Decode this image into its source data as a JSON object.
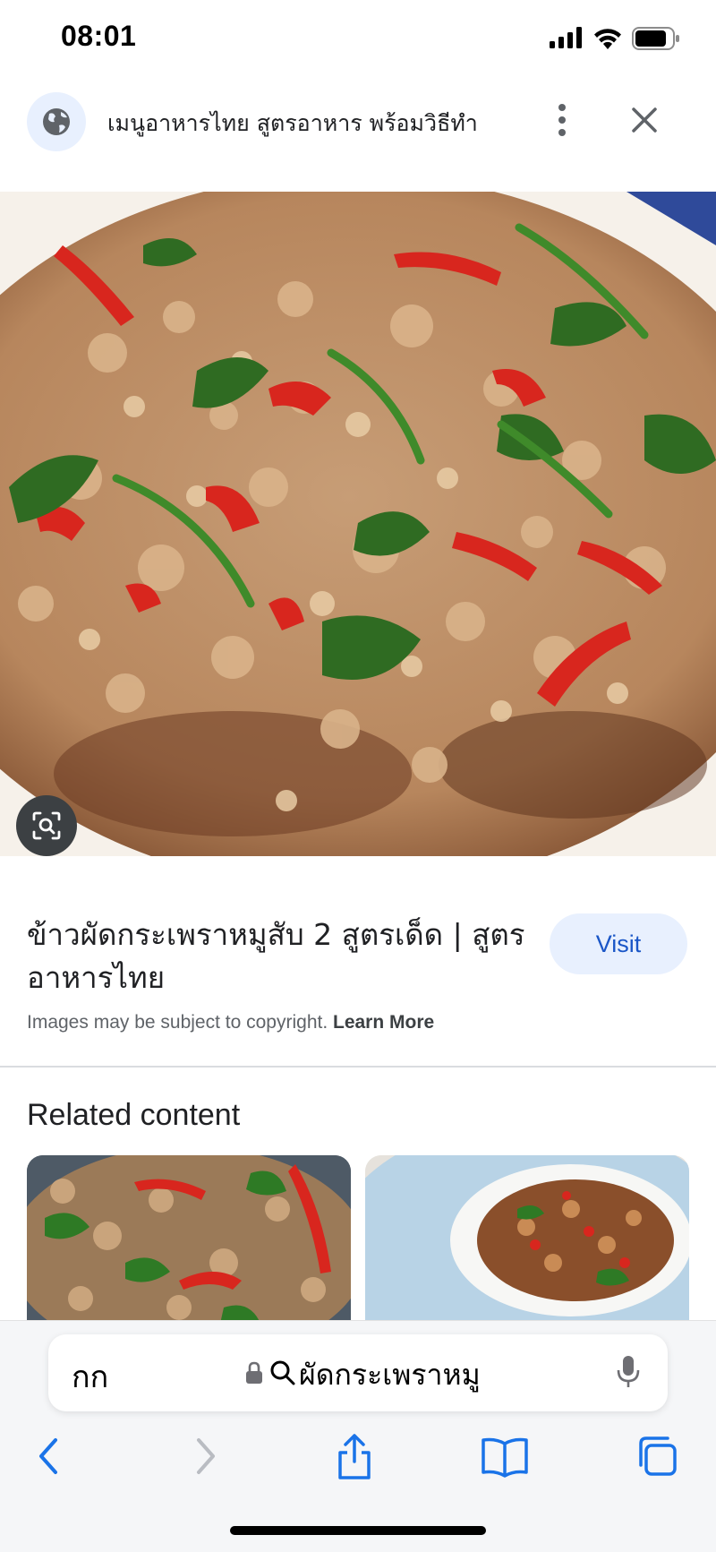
{
  "status_bar": {
    "time": "08:01"
  },
  "header": {
    "title": "เมนูอาหารไทย สูตรอาหาร พร้อมวิธีทำ",
    "globe_icon": "globe-icon",
    "more_icon": "more-vert-icon",
    "close_icon": "close-icon"
  },
  "result": {
    "title": "ข้าวผัดกระเพราหมูสับ 2 สูตรเด็ด | สูตรอาหารไทย",
    "visit_label": "Visit",
    "copyright_text": "Images may be subject to copyright. ",
    "learn_more": "Learn More"
  },
  "related": {
    "heading": "Related content"
  },
  "address_bar": {
    "aa_label": "กก",
    "url_text": "ผัดกระเพราหมู"
  },
  "colors": {
    "accent": "#1a56c7",
    "visit_bg": "#e8f0fe",
    "toolbar_icon": "#1a73e8"
  }
}
